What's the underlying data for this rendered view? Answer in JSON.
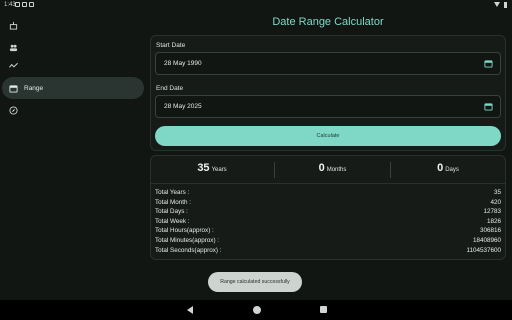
{
  "status_bar": {
    "time": "1:43"
  },
  "sidebar": {
    "items": [
      {
        "label": "",
        "icon": "cake-icon"
      },
      {
        "label": "",
        "icon": "people-icon"
      },
      {
        "label": "",
        "icon": "timeline-icon"
      },
      {
        "label": "Range",
        "icon": "calendar-icon",
        "active": true
      },
      {
        "label": "",
        "icon": "compass-icon"
      }
    ]
  },
  "title": "Date Range Calculator",
  "form": {
    "start_label": "Start Date",
    "start_value": "28 May 1990",
    "end_label": "End Date",
    "end_value": "28 May 2025",
    "calculate_label": "Calculate"
  },
  "summary": {
    "years": "35",
    "years_unit": "Years",
    "months": "0",
    "months_unit": "Months",
    "days": "0",
    "days_unit": "Days"
  },
  "stats": [
    {
      "label": "Total Years :",
      "value": "35"
    },
    {
      "label": "Total Month :",
      "value": "420"
    },
    {
      "label": "Total Days :",
      "value": "12783"
    },
    {
      "label": "Total Week :",
      "value": "1826"
    },
    {
      "label": "Total Hours(approx) :",
      "value": "306816"
    },
    {
      "label": "Total Minutes(approx) :",
      "value": "18408960"
    },
    {
      "label": "Total Seconds(approx) :",
      "value": "1104537600"
    }
  ],
  "toast": "Range calculated successfully",
  "colors": {
    "accent": "#7fd8c6",
    "background": "#121613",
    "active_nav": "#2a3531"
  }
}
